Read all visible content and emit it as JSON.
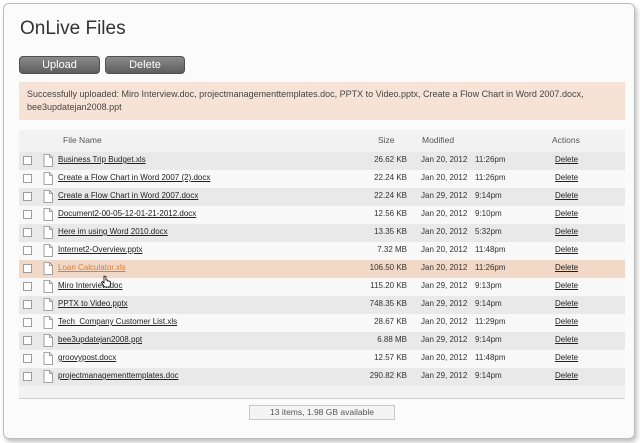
{
  "app": {
    "title": "OnLive Files"
  },
  "toolbar": {
    "upload_label": "Upload",
    "delete_label": "Delete"
  },
  "notice": {
    "text": "Successfully uploaded: Miro Interview.doc, projectmanagementtemplates.doc, PPTX to Video.pptx, Create a Flow Chart in Word 2007.docx, bee3updatejan2008.ppt"
  },
  "table": {
    "headers": {
      "filename": "File Name",
      "size": "Size",
      "modified": "Modified",
      "actions": "Actions"
    },
    "rows": [
      {
        "name": "Business Trip Budget.xls",
        "size": "26.62 KB",
        "date": "Jan 20, 2012",
        "time": "11:26pm",
        "action": "Delete"
      },
      {
        "name": "Create a Flow Chart in Word 2007 (2).docx",
        "size": "22.24 KB",
        "date": "Jan 20, 2012",
        "time": "11:26pm",
        "action": "Delete"
      },
      {
        "name": "Create a Flow Chart in Word 2007.docx",
        "size": "22.24 KB",
        "date": "Jan 29, 2012",
        "time": "9:14pm",
        "action": "Delete"
      },
      {
        "name": "Document2-00-05-12-01-21-2012.docx",
        "size": "12.56 KB",
        "date": "Jan 20, 2012",
        "time": "9:10pm",
        "action": "Delete"
      },
      {
        "name": "Here im using Word 2010.docx",
        "size": "13.35 KB",
        "date": "Jan 20, 2012",
        "time": "5:32pm",
        "action": "Delete"
      },
      {
        "name": "Internet2-Overview.pptx",
        "size": "7.32 MB",
        "date": "Jan 20, 2012",
        "time": "11:48pm",
        "action": "Delete"
      },
      {
        "name": "Loan Calculator.xls",
        "size": "106.50 KB",
        "date": "Jan 20, 2012",
        "time": "11:26pm",
        "action": "Delete"
      },
      {
        "name": "Miro Interview.doc",
        "size": "115.20 KB",
        "date": "Jan 29, 2012",
        "time": "9:13pm",
        "action": "Delete"
      },
      {
        "name": "PPTX to Video.pptx",
        "size": "748.35 KB",
        "date": "Jan 29, 2012",
        "time": "9:14pm",
        "action": "Delete"
      },
      {
        "name": "Tech_Company Customer List.xls",
        "size": "28.67 KB",
        "date": "Jan 20, 2012",
        "time": "11:29pm",
        "action": "Delete"
      },
      {
        "name": "bee3updatejan2008.ppt",
        "size": "6.88 MB",
        "date": "Jan 29, 2012",
        "time": "9:14pm",
        "action": "Delete"
      },
      {
        "name": "groovypost.docx",
        "size": "12.57 KB",
        "date": "Jan 20, 2012",
        "time": "11:48pm",
        "action": "Delete"
      },
      {
        "name": "projectmanagementtemplates.doc",
        "size": "290.82 KB",
        "date": "Jan 29, 2012",
        "time": "9:14pm",
        "action": "Delete"
      }
    ],
    "highlighted_row": 6
  },
  "footer": {
    "status": "13 items, 1.98 GB available"
  },
  "colors": {
    "highlight_row": "#f2d8c6",
    "hovered_link": "#e07b35",
    "notice_bg": "#f7e3d6",
    "button": "#6e6e6e"
  },
  "icons": {
    "file": "document-icon",
    "checkbox": "checkbox-icon",
    "cursor": "hand-pointer-icon"
  }
}
